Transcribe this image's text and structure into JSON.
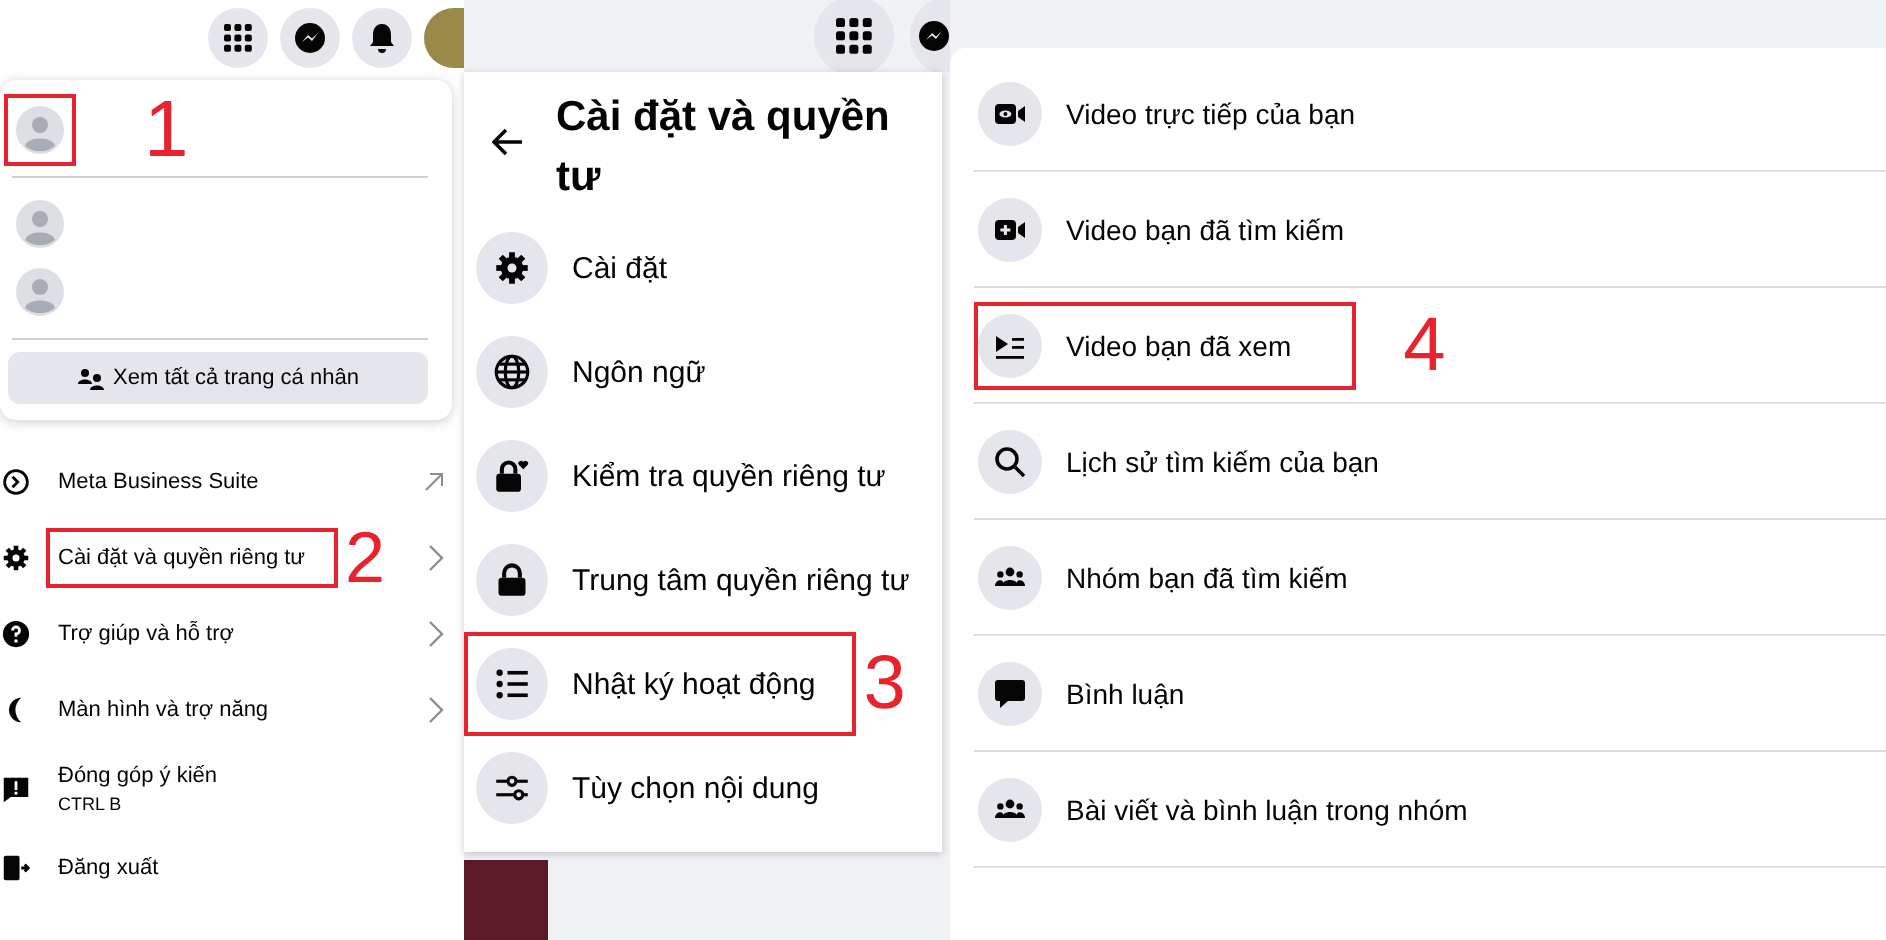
{
  "panel_1": {
    "profiles": [
      {
        "highlighted": true,
        "step": "1"
      },
      {
        "highlighted": false
      },
      {
        "highlighted": false
      }
    ],
    "see_all_button": "Xem tất cả trang cá nhân",
    "menu": [
      {
        "label": "Meta Business Suite",
        "highlighted": false
      },
      {
        "label": "Cài đặt và quyền riêng tư",
        "highlighted": true,
        "step": "2"
      },
      {
        "label": "Trợ giúp và hỗ trợ",
        "highlighted": false
      },
      {
        "label": "Màn hình và trợ năng",
        "highlighted": false
      },
      {
        "label": "Đóng góp ý kiến",
        "sub": "CTRL B",
        "highlighted": false
      },
      {
        "label": "Đăng xuất",
        "highlighted": false
      }
    ]
  },
  "panel_2": {
    "title_lines": [
      "Cài đặt và quyền",
      "tư"
    ],
    "menu": [
      {
        "label": "Cài đặt",
        "highlighted": false
      },
      {
        "label": "Ngôn ngữ",
        "highlighted": false
      },
      {
        "label": "Kiểm tra quyền riêng tư",
        "highlighted": false
      },
      {
        "label": "Trung tâm quyền riêng tư",
        "highlighted": false
      },
      {
        "label": "Nhật ký hoạt động",
        "highlighted": true,
        "step": "3"
      },
      {
        "label": "Tùy chọn nội dung",
        "highlighted": false
      }
    ]
  },
  "panel_3": {
    "menu": [
      {
        "label": "Video trực tiếp của bạn",
        "highlighted": false
      },
      {
        "label": "Video bạn đã tìm kiếm",
        "highlighted": false
      },
      {
        "label": "Video bạn đã xem",
        "highlighted": true,
        "step": "4"
      },
      {
        "label": "Lịch sử tìm kiếm của bạn",
        "highlighted": false
      },
      {
        "label": "Nhóm bạn đã tìm kiếm",
        "highlighted": false
      },
      {
        "label": "Bình luận",
        "highlighted": false
      },
      {
        "label": "Bài viết và bình luận trong nhóm",
        "highlighted": false
      }
    ]
  }
}
